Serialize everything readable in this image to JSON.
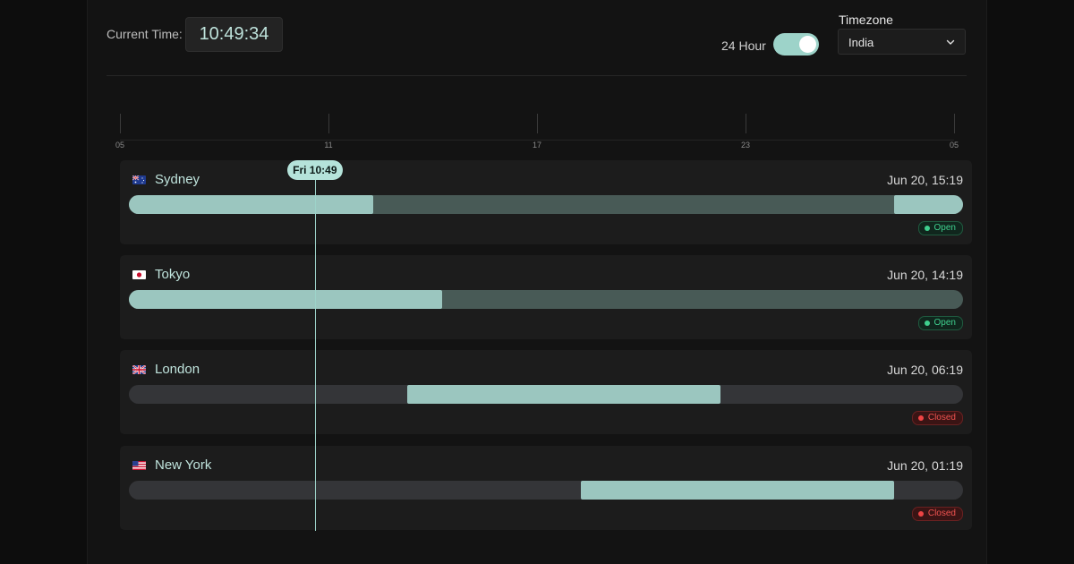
{
  "header": {
    "current_time_label": "Current Time:",
    "current_time_value": "10:49:34",
    "hour_format_label": "24 Hour",
    "hour_format_on": true,
    "timezone_label": "Timezone",
    "timezone_value": "India"
  },
  "timeline": {
    "ticks": [
      "05",
      "11",
      "17",
      "23",
      "05"
    ],
    "now_label": "Fri 10:49",
    "now_position": 0.223
  },
  "cities": [
    {
      "name": "Sydney",
      "flag": "australia-flag-icon",
      "date": "Jun 20, 15:19",
      "status": "Open",
      "status_type": "open",
      "track_color": "#485a56",
      "sessions": [
        [
          0.0,
          0.293
        ],
        [
          0.917,
          1.0
        ]
      ]
    },
    {
      "name": "Tokyo",
      "flag": "japan-flag-icon",
      "date": "Jun 20, 14:19",
      "status": "Open",
      "status_type": "open",
      "track_color": "#485a56",
      "sessions": [
        [
          0.0,
          0.376
        ]
      ]
    },
    {
      "name": "London",
      "flag": "uk-flag-icon",
      "date": "Jun 20, 06:19",
      "status": "Closed",
      "status_type": "closed",
      "track_color": "#343538",
      "sessions": [
        [
          0.334,
          0.709
        ]
      ]
    },
    {
      "name": "New York",
      "flag": "usa-flag-icon",
      "date": "Jun 20, 01:19",
      "status": "Closed",
      "status_type": "closed",
      "track_color": "#343538",
      "sessions": [
        [
          0.542,
          0.917
        ]
      ]
    }
  ],
  "colors": {
    "accent": "#9dd3c9",
    "session": "#9bc6bf",
    "open": "#3fcf8e",
    "closed": "#ef4444"
  }
}
